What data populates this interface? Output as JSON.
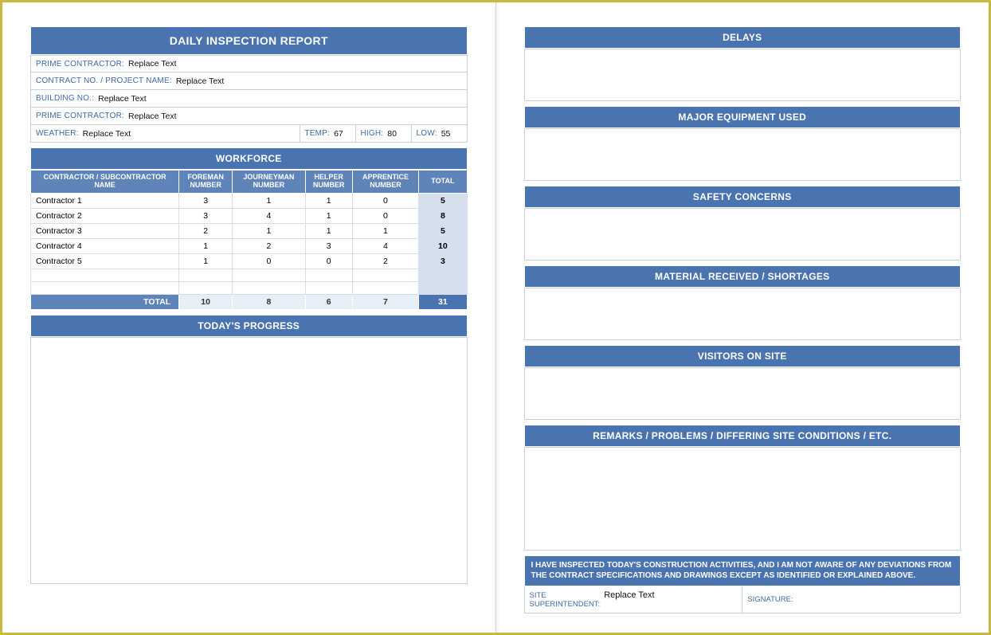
{
  "report": {
    "title": "DAILY INSPECTION REPORT",
    "fields": {
      "prime_contractor_label": "PRIME CONTRACTOR:",
      "prime_contractor_value": "Replace Text",
      "contract_no_label": "CONTRACT NO. / PROJECT NAME:",
      "contract_no_value": "Replace Text",
      "building_no_label": "BUILDING NO.:",
      "building_no_value": "Replace Text",
      "prime_contractor2_label": "PRIME CONTRACTOR:",
      "prime_contractor2_value": "Replace Text",
      "weather_label": "WEATHER:",
      "weather_value": "Replace Text",
      "temp_label": "TEMP:",
      "temp_value": "67",
      "high_label": "HIGH:",
      "high_value": "80",
      "low_label": "LOW:",
      "low_value": "55"
    },
    "workforce": {
      "header": "WORKFORCE",
      "columns": {
        "c1": "CONTRACTOR / SUBCONTRACTOR<br>NAME",
        "c2": "FOREMAN<br>NUMBER",
        "c3": "JOURNEYMAN<br>NUMBER",
        "c4": "HELPER<br>NUMBER",
        "c5": "APPRENTICE<br>NUMBER",
        "c6": "TOTAL"
      },
      "rows": [
        {
          "name": "Contractor 1",
          "foreman": "3",
          "journeyman": "1",
          "helper": "1",
          "apprentice": "0",
          "total": "5"
        },
        {
          "name": "Contractor 2",
          "foreman": "3",
          "journeyman": "4",
          "helper": "1",
          "apprentice": "0",
          "total": "8"
        },
        {
          "name": "Contractor 3",
          "foreman": "2",
          "journeyman": "1",
          "helper": "1",
          "apprentice": "1",
          "total": "5"
        },
        {
          "name": "Contractor 4",
          "foreman": "1",
          "journeyman": "2",
          "helper": "3",
          "apprentice": "4",
          "total": "10"
        },
        {
          "name": "Contractor 5",
          "foreman": "1",
          "journeyman": "0",
          "helper": "0",
          "apprentice": "2",
          "total": "3"
        }
      ],
      "total_label": "TOTAL",
      "totals": {
        "foreman": "10",
        "journeyman": "8",
        "helper": "6",
        "apprentice": "7",
        "grand": "31"
      }
    },
    "progress_header": "TODAY'S PROGRESS"
  },
  "right": {
    "delays": "DELAYS",
    "equipment": "MAJOR EQUIPMENT USED",
    "safety": "SAFETY CONCERNS",
    "material": "MATERIAL RECEIVED / SHORTAGES",
    "visitors": "VISITORS ON SITE",
    "remarks": "REMARKS / PROBLEMS / DIFFERING SITE CONDITIONS / ETC.",
    "cert": "I HAVE INSPECTED TODAY'S CONSTRUCTION ACTIVITIES, AND I AM NOT AWARE OF ANY DEVIATIONS FROM THE CONTRACT SPECIFICATIONS AND DRAWINGS EXCEPT AS IDENTIFIED OR EXPLAINED ABOVE.",
    "super_label": "SITE SUPERINTENDENT:",
    "super_value": "Replace Text",
    "sig_label": "SIGNATURE:"
  }
}
